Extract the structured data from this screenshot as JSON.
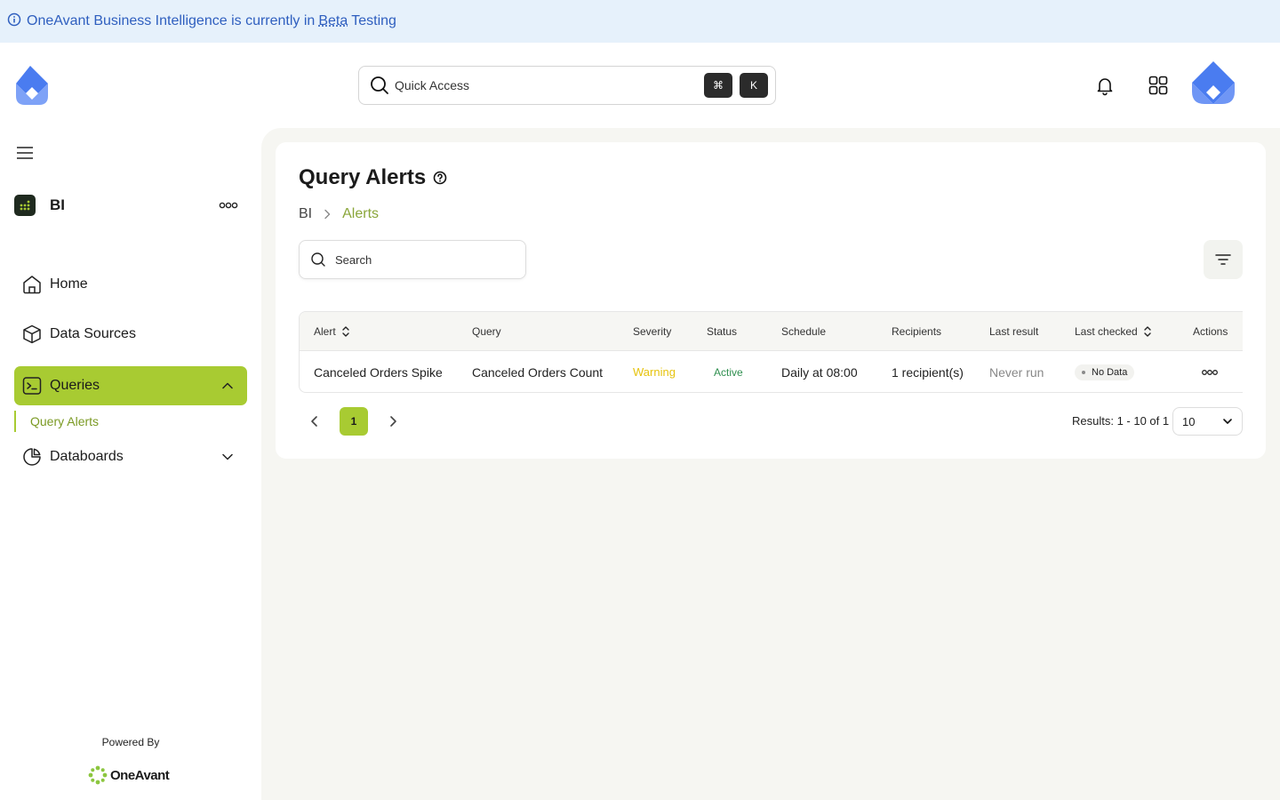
{
  "banner": {
    "prefix": "OneAvant Business Intelligence is currently in",
    "beta": "Beta",
    "suffix": "Testing"
  },
  "header": {
    "quick_access_label": "Quick Access",
    "shortcut_keys": [
      "⌘",
      "K"
    ]
  },
  "sidebar": {
    "app_name": "BI",
    "items": [
      {
        "label": "Home",
        "icon": "home-icon"
      },
      {
        "label": "Data Sources",
        "icon": "cube-icon"
      },
      {
        "label": "Queries",
        "icon": "terminal-icon",
        "active": true,
        "expanded": true
      },
      {
        "label": "Databoards",
        "icon": "pie-chart-icon"
      }
    ],
    "sub_item": "Query Alerts",
    "powered_by": "Powered By",
    "brand": "OneAvant"
  },
  "main": {
    "title": "Query Alerts",
    "breadcrumb": {
      "root": "BI",
      "current": "Alerts"
    },
    "search_placeholder": "Search",
    "table": {
      "headers": [
        "Alert",
        "Query",
        "Severity",
        "Status",
        "Schedule",
        "Recipients",
        "Last result",
        "Last checked",
        "Actions"
      ],
      "rows": [
        {
          "alert": "Canceled Orders Spike",
          "query": "Canceled Orders Count",
          "severity": "Warning",
          "status": "Active",
          "schedule": "Daily at 08:00",
          "recipients": "1 recipient(s)",
          "last_result": "Never run",
          "last_checked": "No Data"
        }
      ]
    },
    "pagination": {
      "current_page": "1",
      "results": "Results: 1 - 10 of 1",
      "page_size": "10"
    }
  },
  "colors": {
    "accent": "#a8cb32",
    "banner_bg": "#e6f1fb",
    "banner_text": "#2f5fbf",
    "warning": "#e6c30e",
    "active": "#2f8f4f"
  }
}
